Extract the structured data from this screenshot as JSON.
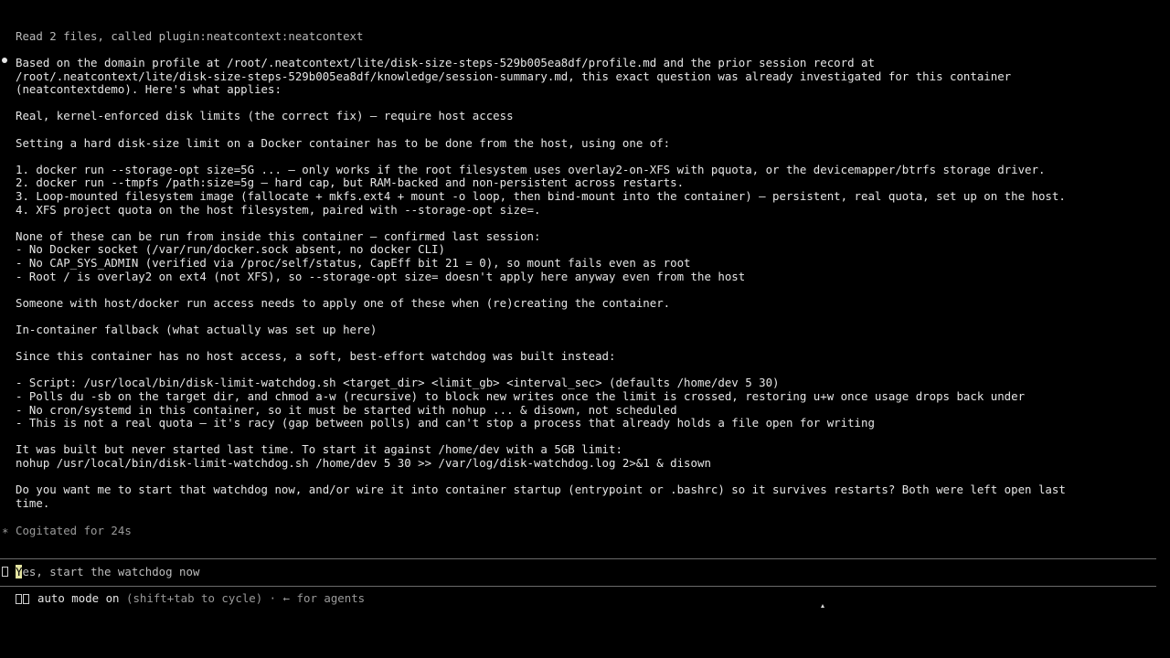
{
  "transcript": {
    "tool_summary": "Read 2 files, called plugin:neatcontext:neatcontext",
    "lines": [
      "Based on the domain profile at /root/.neatcontext/lite/disk-size-steps-529b005ea8df/profile.md and the prior session record at",
      "/root/.neatcontext/lite/disk-size-steps-529b005ea8df/knowledge/session-summary.md, this exact question was already investigated for this container",
      "(neatcontextdemo). Here's what applies:",
      "",
      "Real, kernel-enforced disk limits (the correct fix) — require host access",
      "",
      "Setting a hard disk-size limit on a Docker container has to be done from the host, using one of:",
      "",
      "1. docker run --storage-opt size=5G ... — only works if the root filesystem uses overlay2-on-XFS with pquota, or the devicemapper/btrfs storage driver.",
      "2. docker run --tmpfs /path:size=5g — hard cap, but RAM-backed and non-persistent across restarts.",
      "3. Loop-mounted filesystem image (fallocate + mkfs.ext4 + mount -o loop, then bind-mount into the container) — persistent, real quota, set up on the host.",
      "4. XFS project quota on the host filesystem, paired with --storage-opt size=.",
      "",
      "None of these can be run from inside this container — confirmed last session:",
      "- No Docker socket (/var/run/docker.sock absent, no docker CLI)",
      "- No CAP_SYS_ADMIN (verified via /proc/self/status, CapEff bit 21 = 0), so mount fails even as root",
      "- Root / is overlay2 on ext4 (not XFS), so --storage-opt size= doesn't apply here anyway even from the host",
      "",
      "Someone with host/docker run access needs to apply one of these when (re)creating the container.",
      "",
      "In-container fallback (what actually was set up here)",
      "",
      "Since this container has no host access, a soft, best-effort watchdog was built instead:",
      "",
      "- Script: /usr/local/bin/disk-limit-watchdog.sh <target_dir> <limit_gb> <interval_sec> (defaults /home/dev 5 30)",
      "- Polls du -sb on the target dir, and chmod a-w (recursive) to block new writes once the limit is crossed, restoring u+w once usage drops back under",
      "- No cron/systemd in this container, so it must be started with nohup ... & disown, not scheduled",
      "- This is not a real quota — it's racy (gap between polls) and can't stop a process that already holds a file open for writing",
      "",
      "It was built but never started last time. To start it against /home/dev with a 5GB limit:",
      "nohup /usr/local/bin/disk-limit-watchdog.sh /home/dev 5 30 >> /var/log/disk-watchdog.log 2>&1 & disown",
      "",
      "Do you want me to start that watchdog now, and/or wire it into container startup (entrypoint or .bashrc) so it survives restarts? Both were left open last",
      "time."
    ],
    "cogitated_star": "*",
    "cogitated": "Cogitated for 24s"
  },
  "prompt": {
    "cursor_char": "Y",
    "rest": "es, start the watchdog now"
  },
  "status_bar": {
    "mode_label": "auto mode on",
    "mode_hint": "(shift+tab to cycle)",
    "separator": "·",
    "agents_hint": "← for agents"
  }
}
